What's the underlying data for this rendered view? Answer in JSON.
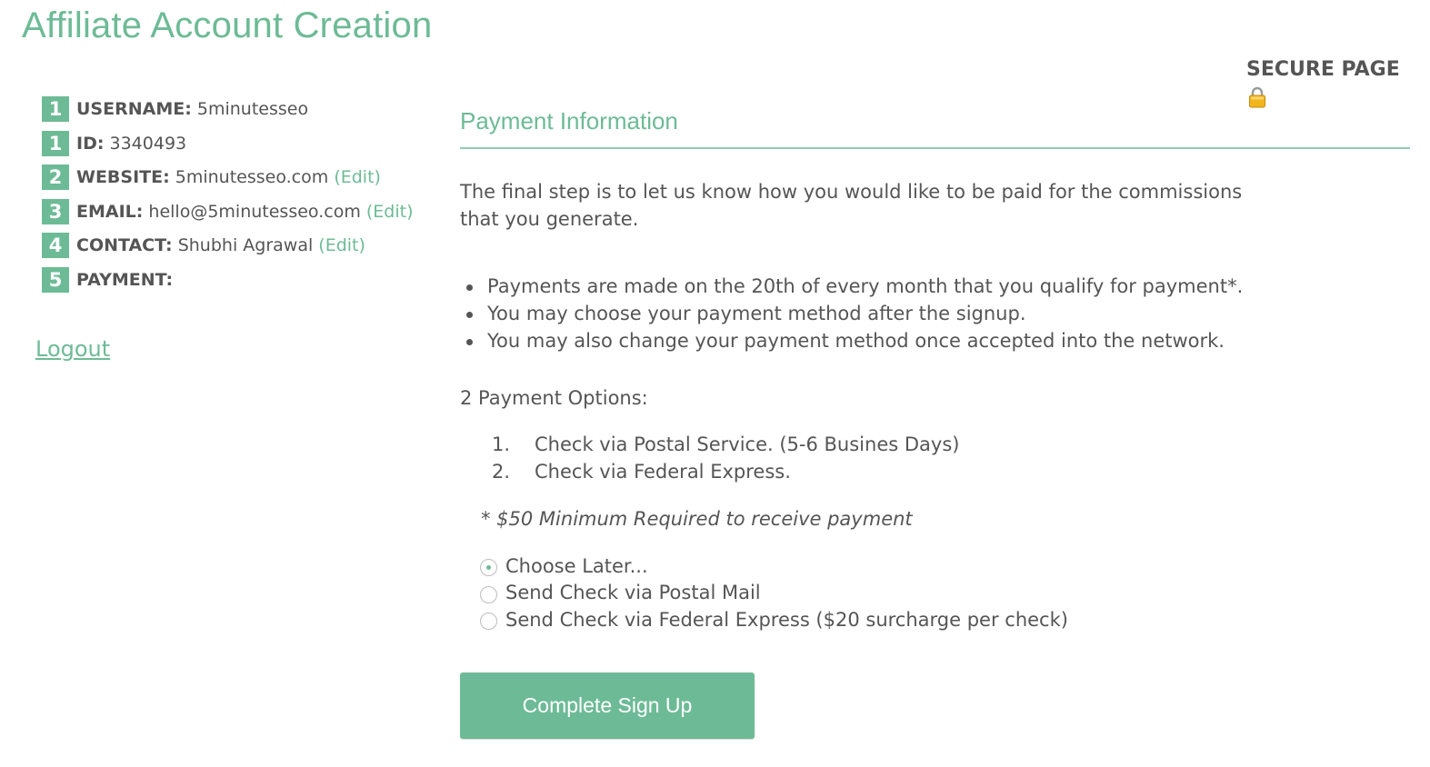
{
  "page": {
    "title": "Affiliate Account Creation"
  },
  "steps": [
    {
      "num": "1",
      "key": "USERNAME:",
      "value": "5minutesseo",
      "edit": ""
    },
    {
      "num": "1",
      "key": "ID:",
      "value": "3340493",
      "edit": ""
    },
    {
      "num": "2",
      "key": "WEBSITE:",
      "value": "5minutesseo.com",
      "edit": "(Edit)"
    },
    {
      "num": "3",
      "key": "EMAIL:",
      "value": "hello@5minutesseo.com",
      "edit": "(Edit)"
    },
    {
      "num": "4",
      "key": "CONTACT:",
      "value": "Shubhi Agrawal",
      "edit": "(Edit)"
    },
    {
      "num": "5",
      "key": "PAYMENT:",
      "value": "",
      "edit": ""
    }
  ],
  "logout_label": "Logout",
  "secure": {
    "label": "SECURE PAGE",
    "icon": "lock-icon"
  },
  "payment": {
    "section_title": "Payment Information",
    "intro": "The final step is to let us know how you would like to be paid for the commissions that you generate.",
    "bullets": [
      "Payments are made on the 20th of every month that you qualify for payment*.",
      "You may choose your payment method after the signup.",
      "You may also change your payment method once accepted into the network."
    ],
    "options_heading": "2 Payment Options:",
    "options": [
      {
        "num": "1.",
        "label": "Check via Postal Service. (5-6 Busines Days)"
      },
      {
        "num": "2.",
        "label": "Check via Federal Express."
      }
    ],
    "minimum_note": "* $50 Minimum Required to receive payment",
    "radios": [
      {
        "label": "Choose Later...",
        "checked": true
      },
      {
        "label": "Send Check via Postal Mail",
        "checked": false
      },
      {
        "label": "Send Check via Federal Express ($20 surcharge per check)",
        "checked": false
      }
    ],
    "submit_label": "Complete Sign Up"
  },
  "colors": {
    "accent": "#6dbb96",
    "text": "#555555",
    "lock": "#f2b51c"
  }
}
